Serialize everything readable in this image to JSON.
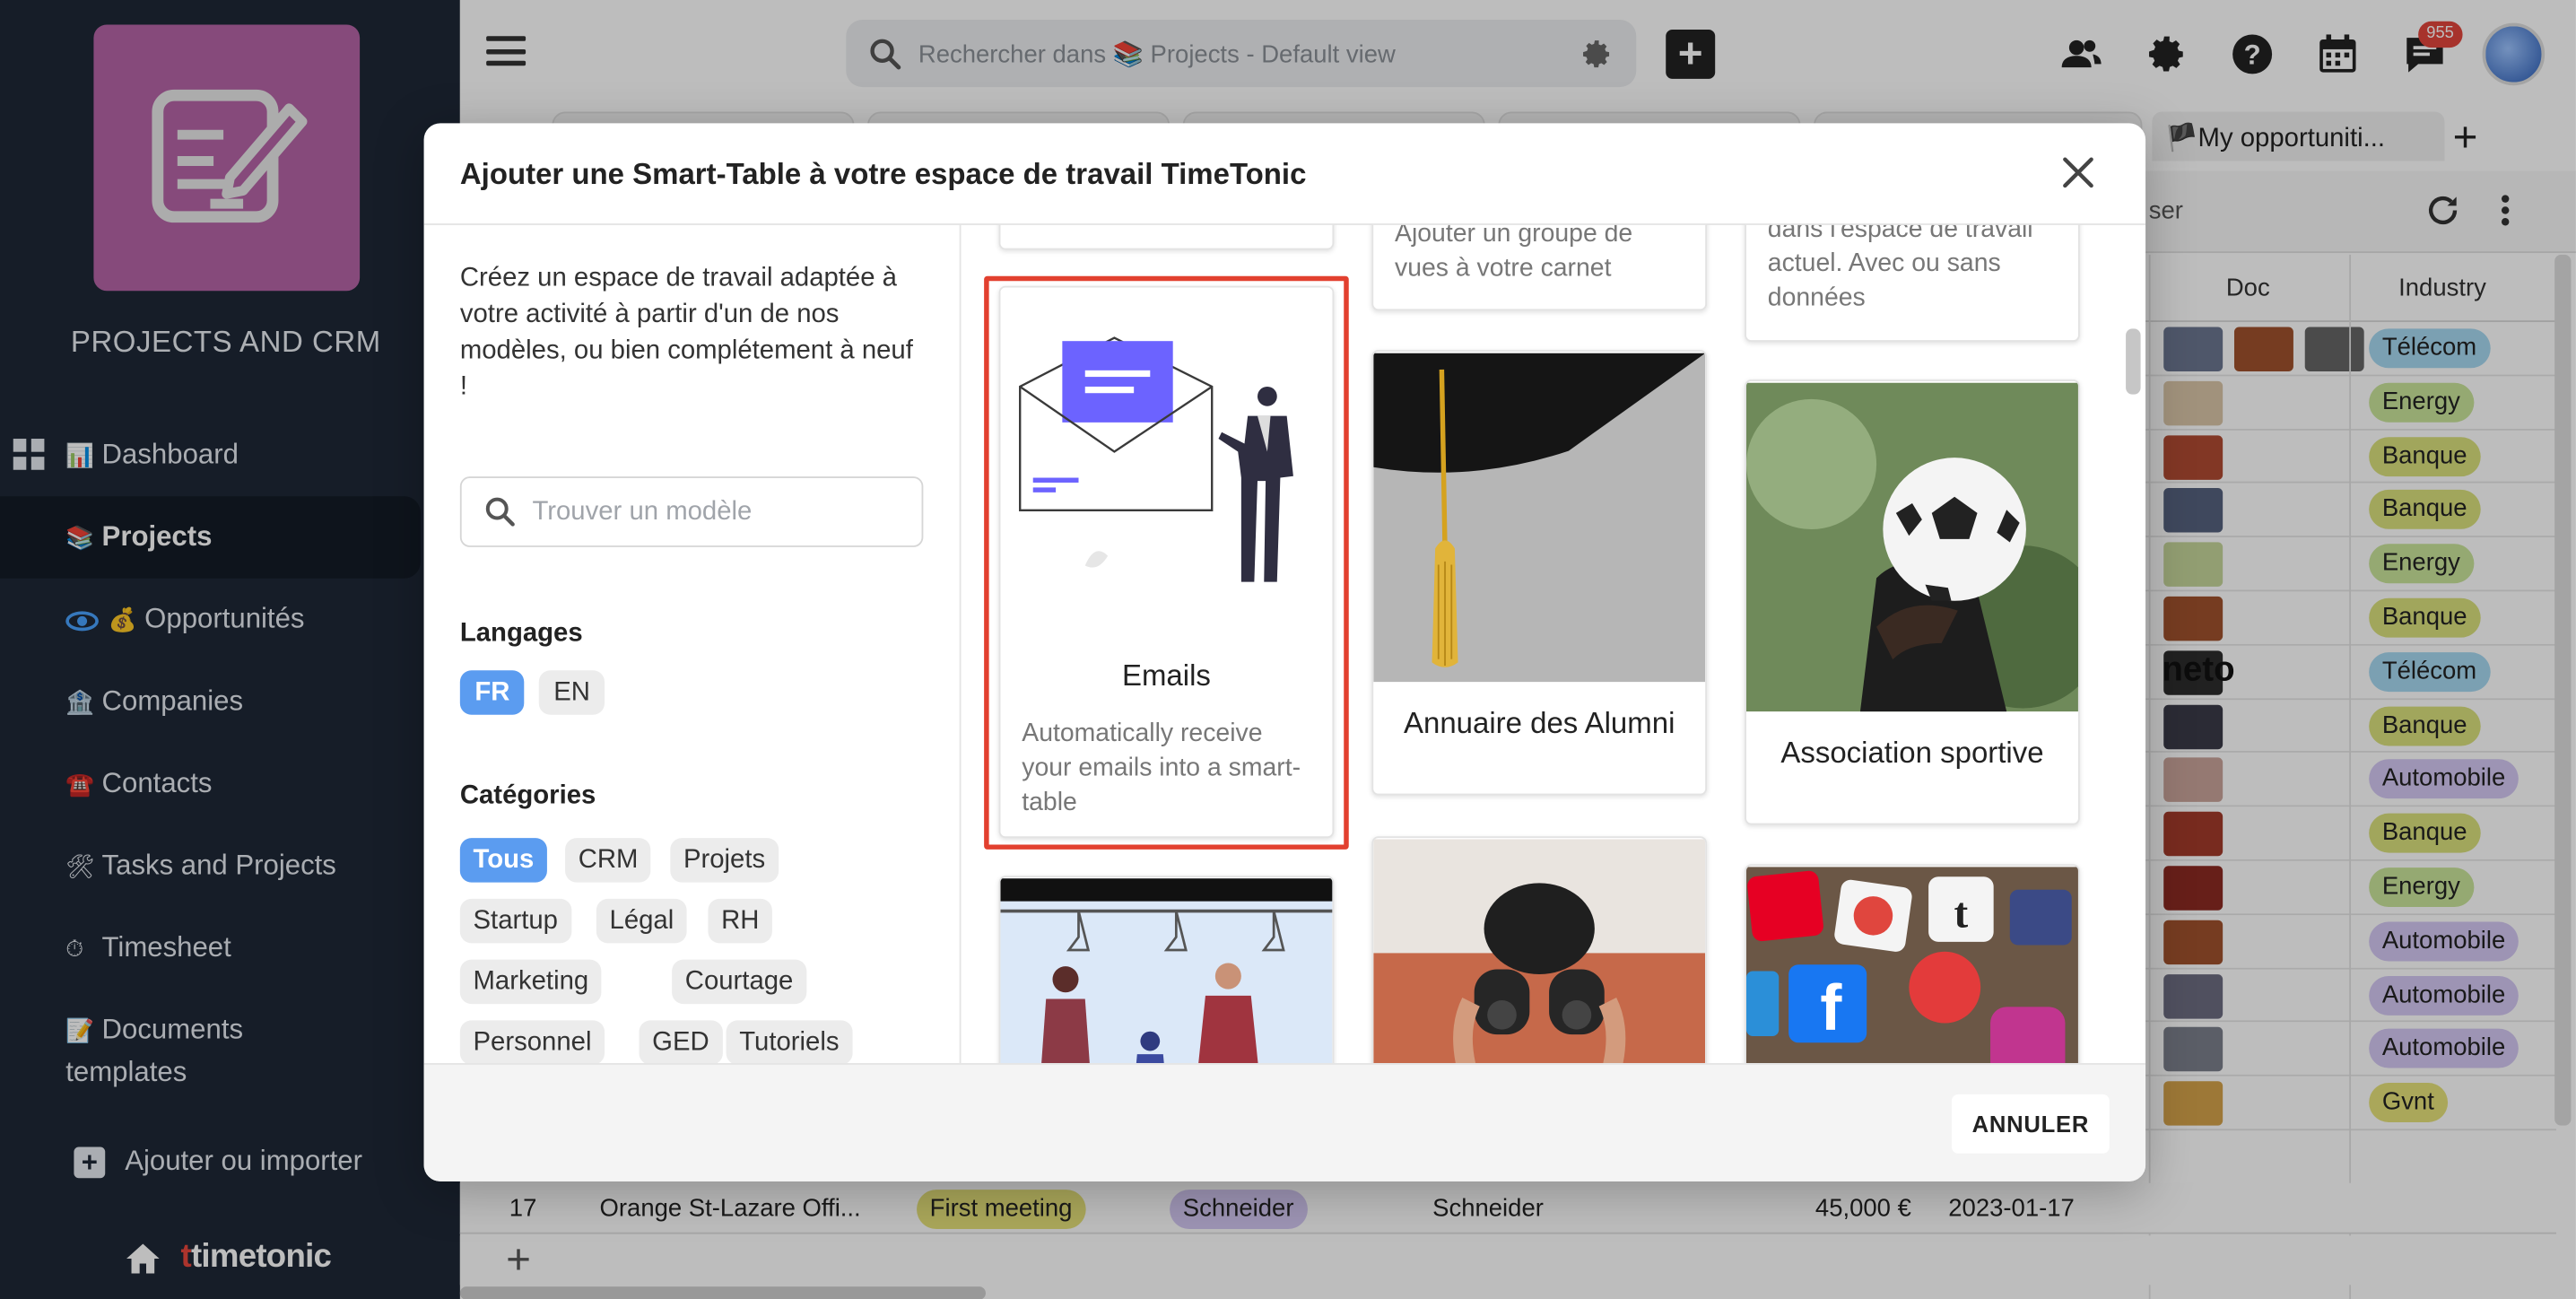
{
  "app": {
    "title": "PROJECTS AND CRM"
  },
  "sidebar": {
    "items": [
      {
        "emoji": "📊",
        "label": "Dashboard"
      },
      {
        "emoji": "📚",
        "label": "Projects"
      },
      {
        "emoji": "💰",
        "label": "Opportunités"
      },
      {
        "emoji": "🏦",
        "label": "Companies"
      },
      {
        "emoji": "☎️",
        "label": "Contacts"
      },
      {
        "emoji": "🛠",
        "label": "Tasks and Projects"
      },
      {
        "emoji": "⏱",
        "label": "Timesheet"
      },
      {
        "emoji": "📝",
        "label": "Documents templates"
      }
    ],
    "add_import": "Ajouter ou importer",
    "brand": "timetonic"
  },
  "topbar": {
    "search_placeholder": "Rechercher dans 📚 Projects - Default view",
    "notifications_count": "955"
  },
  "tabs": {
    "opportunities": "🏴My opportuniti..."
  },
  "toolbar": {
    "partial_text": "ser"
  },
  "table": {
    "headers": {
      "doc": "Doc",
      "industry": "Industry"
    },
    "industries": [
      "Télécom",
      "Energy",
      "Banque",
      "Banque",
      "Energy",
      "Banque",
      "Télécom",
      "Banque",
      "Automobile",
      "Banque",
      "Energy",
      "Automobile",
      "Automobile",
      "Automobile",
      "Gvnt"
    ],
    "partial_logo_text": "neto",
    "last_row": {
      "num": "17",
      "name": "Orange St-Lazare Offi...",
      "stage": "First meeting",
      "owner_tag": "Schneider",
      "company": "Schneider",
      "amount": "45,000 €",
      "date": "2023-01-17"
    },
    "colors": {
      "Télécom": "#a6d8f0",
      "Energy": "#c9e49a",
      "Banque": "#d9e07c",
      "Automobile": "#d4c8f3",
      "Gvnt": "#e6e27a"
    }
  },
  "modal": {
    "title": "Ajouter une Smart-Table à votre espace de travail TimeTonic",
    "description": "Créez un espace de travail adaptée à votre activité à partir d'un de nos modèles, ou bien complétement à neuf !",
    "search_placeholder": "Trouver un modèle",
    "languages_label": "Langages",
    "languages": [
      "FR",
      "EN"
    ],
    "categories_label": "Catégories",
    "categories": [
      "Tous",
      "CRM",
      "Projets",
      "Startup",
      "Légal",
      "RH",
      "Marketing",
      "Courtage",
      "Personnel",
      "GED",
      "Tutoriels"
    ],
    "cards": {
      "views_text": "Ajouter un groupe de vues à votre carnet",
      "workspace_text": "dans l'espace de travail actuel. Avec ou sans données",
      "emails_title": "Emails",
      "emails_text": "Automatically receive your emails into a smart-table",
      "alumni_title": "Annuaire des Alumni",
      "sport_title": "Association sportive"
    },
    "cancel_label": "ANNULER"
  }
}
